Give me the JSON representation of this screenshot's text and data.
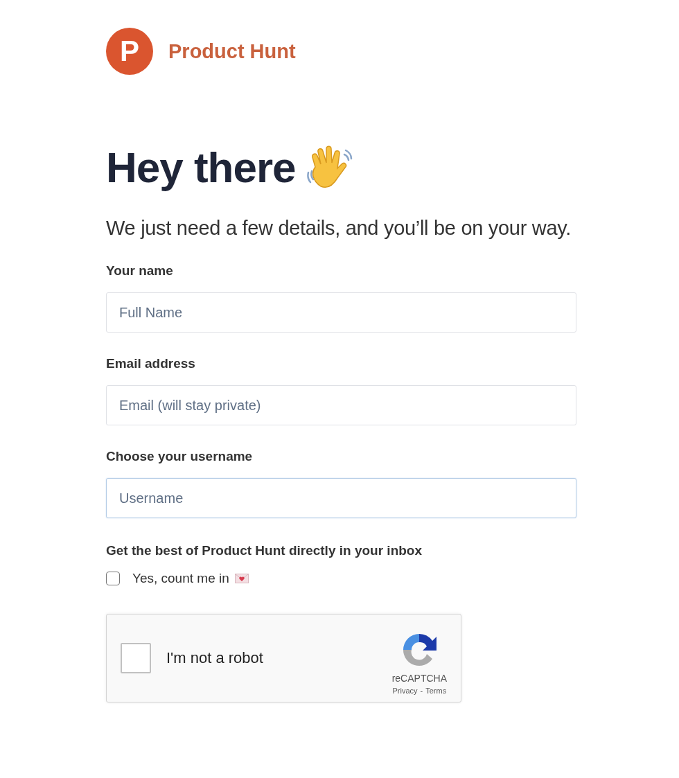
{
  "logo": {
    "letter": "P",
    "name": "Product Hunt"
  },
  "heading": "Hey there",
  "subtitle": "We just need a few details, and you’ll be on your way.",
  "fields": [
    {
      "label": "Your name",
      "placeholder": "Full Name",
      "focused": false
    },
    {
      "label": "Email address",
      "placeholder": "Email (will stay private)",
      "focused": false
    },
    {
      "label": "Choose your username",
      "placeholder": "Username",
      "focused": true
    }
  ],
  "newsletter": {
    "label": "Get the best of Product Hunt directly in your inbox",
    "option": "Yes, count me in",
    "checked": false
  },
  "captcha": {
    "text": "I'm not a robot",
    "checked": false,
    "brand": "reCAPTCHA",
    "links": [
      "Privacy",
      "Terms"
    ],
    "separator": "-"
  }
}
